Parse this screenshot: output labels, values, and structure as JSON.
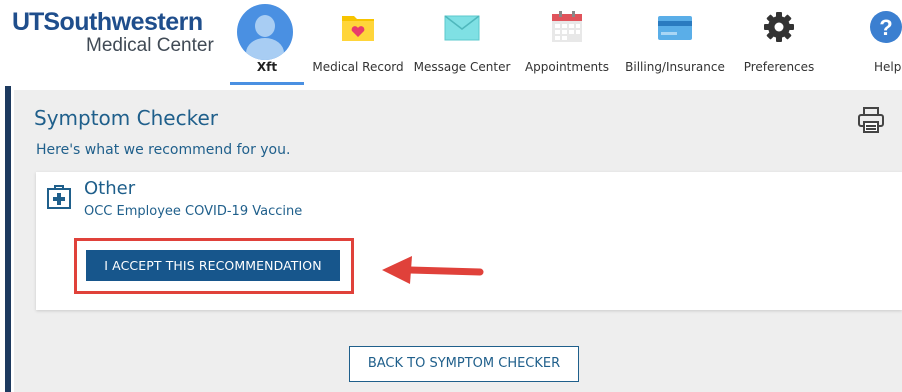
{
  "header": {
    "logo": {
      "line1_ut": "UT",
      "line1_rest": "Southwestern",
      "line2": "Medical Center"
    },
    "user": {
      "name": "Xft"
    },
    "nav": [
      {
        "label": "Medical Record",
        "icon": "medical-record-folder-icon"
      },
      {
        "label": "Message Center",
        "icon": "envelope-icon"
      },
      {
        "label": "Appointments",
        "icon": "calendar-icon"
      },
      {
        "label": "Billing/Insurance",
        "icon": "credit-card-icon"
      },
      {
        "label": "Preferences",
        "icon": "gear-icon"
      },
      {
        "label": "Help",
        "icon": "help-icon"
      }
    ]
  },
  "main": {
    "title": "Symptom Checker",
    "subtitle": "Here's what we recommend for you.",
    "card": {
      "title": "Other",
      "subtitle": "OCC Employee COVID-19 Vaccine",
      "accept_label": "I ACCEPT THIS RECOMMENDATION"
    },
    "back_label": "BACK TO SYMPTOM CHECKER"
  },
  "colors": {
    "brand_blue": "#1f4e8c",
    "link_blue": "#1f5f8b",
    "button_blue": "#17568c",
    "highlight_red": "#e0413a",
    "background": "#eeeeee"
  }
}
